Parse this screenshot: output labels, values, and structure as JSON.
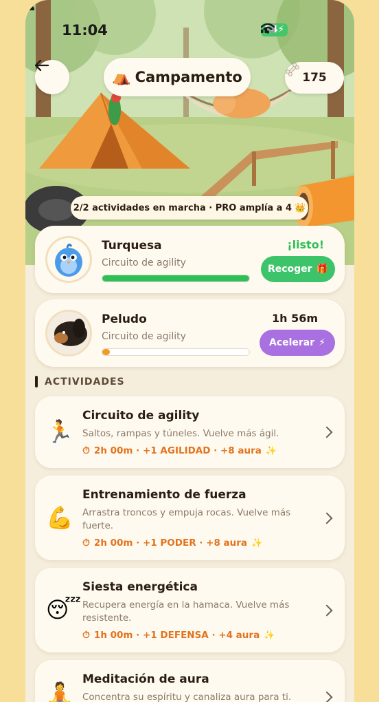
{
  "status": {
    "time": "11:04",
    "battery": "54"
  },
  "header": {
    "title": "Campamento",
    "tent_icon": "⛺",
    "bones": "175"
  },
  "banner": {
    "text": "2/2 actividades en marcha · PRO amplía a 4",
    "crown": "👑"
  },
  "pets": [
    {
      "name": "Turquesa",
      "activity": "Circuito de agility",
      "status": "¡listo!",
      "status_color": "#2fbf59",
      "progress": 1.0,
      "progress_color": "#2fbf59",
      "action_label": "Recoger",
      "action_icon": "🎁",
      "action_color": "#3dc46a"
    },
    {
      "name": "Peludo",
      "activity": "Circuito de agility",
      "status": "1h 56m",
      "status_color": "#2a1d12",
      "progress": 0.04,
      "progress_color": "#f39a1f",
      "action_label": "Acelerar",
      "action_icon": "⚡",
      "action_color": "#a870e0"
    }
  ],
  "section": {
    "title": "ACTIVIDADES"
  },
  "activities": [
    {
      "icon": "🏃",
      "title": "Circuito de agility",
      "desc": "Saltos, rampas y túneles. Vuelve más ágil.",
      "meta": "2h 00m · +1 AGILIDAD · +8 aura",
      "timer": "⏱",
      "sparkle": "✨"
    },
    {
      "icon": "💪",
      "title": "Entrenamiento de fuerza",
      "desc": "Arrastra troncos y empuja rocas. Vuelve más fuerte.",
      "meta": "2h 00m · +1 PODER · +8 aura",
      "timer": "⏱",
      "sparkle": "✨"
    },
    {
      "icon": "😴",
      "title": "Siesta energética",
      "desc": "Recupera energía en la hamaca. Vuelve más resistente.",
      "meta": "1h 00m · +1 DEFENSA · +4 aura",
      "timer": "⏱",
      "sparkle": "✨"
    },
    {
      "icon": "🧘",
      "title": "Meditación de aura",
      "desc": "Concentra su espíritu y canaliza aura para ti."
    }
  ]
}
